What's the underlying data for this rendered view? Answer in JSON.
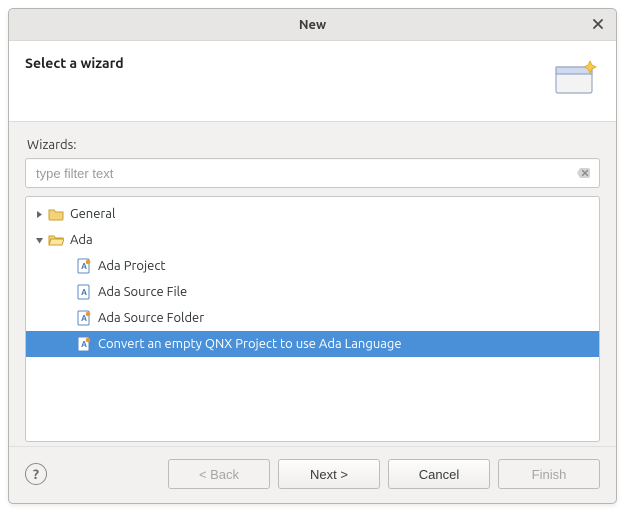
{
  "window": {
    "title": "New"
  },
  "banner": {
    "title": "Select a wizard"
  },
  "body": {
    "wizards_label": "Wizards:",
    "filter_placeholder": "type filter text"
  },
  "tree": {
    "general": {
      "label": "General"
    },
    "ada": {
      "label": "Ada",
      "items": [
        {
          "label": "Ada Project"
        },
        {
          "label": "Ada Source File"
        },
        {
          "label": "Ada Source Folder"
        },
        {
          "label": "Convert an empty QNX Project to use Ada Language"
        }
      ]
    }
  },
  "buttons": {
    "back": "< Back",
    "next": "Next >",
    "cancel": "Cancel",
    "finish": "Finish"
  }
}
